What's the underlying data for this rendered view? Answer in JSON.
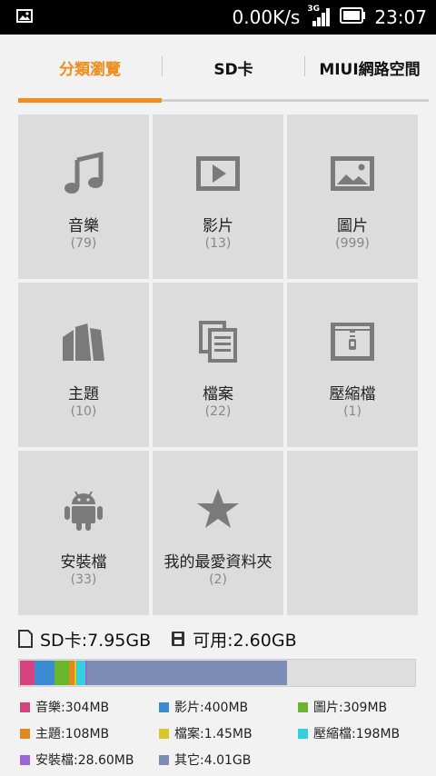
{
  "status_bar": {
    "speed": "0.00K/s",
    "network_type": "3G",
    "time": "23:07",
    "icons": [
      "image-notification-icon",
      "signal-icon",
      "battery-icon"
    ]
  },
  "tabs": [
    {
      "label": "分類瀏覽",
      "active": true
    },
    {
      "label": "SD卡",
      "active": false
    },
    {
      "label": "MIUI網路空間",
      "active": false
    }
  ],
  "categories": [
    {
      "name": "音樂",
      "count": "(79)",
      "icon": "music-note-icon"
    },
    {
      "name": "影片",
      "count": "(13)",
      "icon": "video-icon"
    },
    {
      "name": "圖片",
      "count": "(999)",
      "icon": "picture-icon"
    },
    {
      "name": "主題",
      "count": "(10)",
      "icon": "theme-icon"
    },
    {
      "name": "檔案",
      "count": "(22)",
      "icon": "documents-icon"
    },
    {
      "name": "壓縮檔",
      "count": "(1)",
      "icon": "archive-icon"
    },
    {
      "name": "安裝檔",
      "count": "(33)",
      "icon": "android-icon"
    },
    {
      "name": "我的最愛資料夾",
      "count": "(2)",
      "icon": "star-icon"
    }
  ],
  "storage": {
    "sd_label": "SD卡:7.95GB",
    "free_label": "可用:2.60GB"
  },
  "usage_bar": {
    "segments": [
      {
        "label": "音樂:304MB",
        "color": "#d6417f",
        "fraction": 0.0373
      },
      {
        "label": "影片:400MB",
        "color": "#3a8bd1",
        "fraction": 0.0491
      },
      {
        "label": "圖片:309MB",
        "color": "#6ab52e",
        "fraction": 0.038
      },
      {
        "label": "主題:108MB",
        "color": "#e08a1e",
        "fraction": 0.0133
      },
      {
        "label": "檔案:1.45MB",
        "color": "#d8c82b",
        "fraction": 0.001
      },
      {
        "label": "壓縮檔:198MB",
        "color": "#35cfe0",
        "fraction": 0.0243
      },
      {
        "label": "安裝檔:28.60MB",
        "color": "#9b67d6",
        "fraction": 0.0035
      },
      {
        "label": "其它:4.01GB",
        "color": "#7d8db5",
        "fraction": 0.5044
      }
    ]
  }
}
